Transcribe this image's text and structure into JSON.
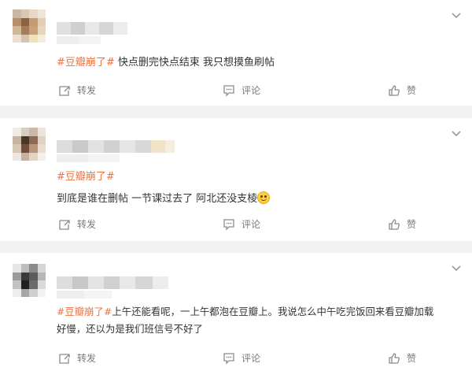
{
  "posts": [
    {
      "tag": "#豆瓣崩了#",
      "text": " 快点删完快点结束 我只想摸鱼刷帖",
      "actions": {
        "repost": "转发",
        "comment": "评论",
        "like": "赞"
      }
    },
    {
      "tag": "#豆瓣崩了#",
      "text": "到底是谁在删帖 一节课过去了 阿北还没支棱",
      "actions": {
        "repost": "转发",
        "comment": "评论",
        "like": "赞"
      }
    },
    {
      "tag": "#豆瓣崩了#",
      "text_line1": "上午还能看呢，一上午都泡在豆瓣上。我说怎么中午吃完饭回来看豆瓣加载",
      "text_line2": "好慢，还以为是我们班信号不好了",
      "actions": {
        "repost": "转发",
        "comment": "评论",
        "like": "赞"
      }
    }
  ],
  "colors": {
    "tag": "#eb7340",
    "text": "#333333",
    "action": "#7a7a7a",
    "background": "#f2f2f2"
  },
  "icons": [
    "chevron-down-icon",
    "repost-icon",
    "comment-icon",
    "like-icon",
    "smile-emoji-icon"
  ]
}
